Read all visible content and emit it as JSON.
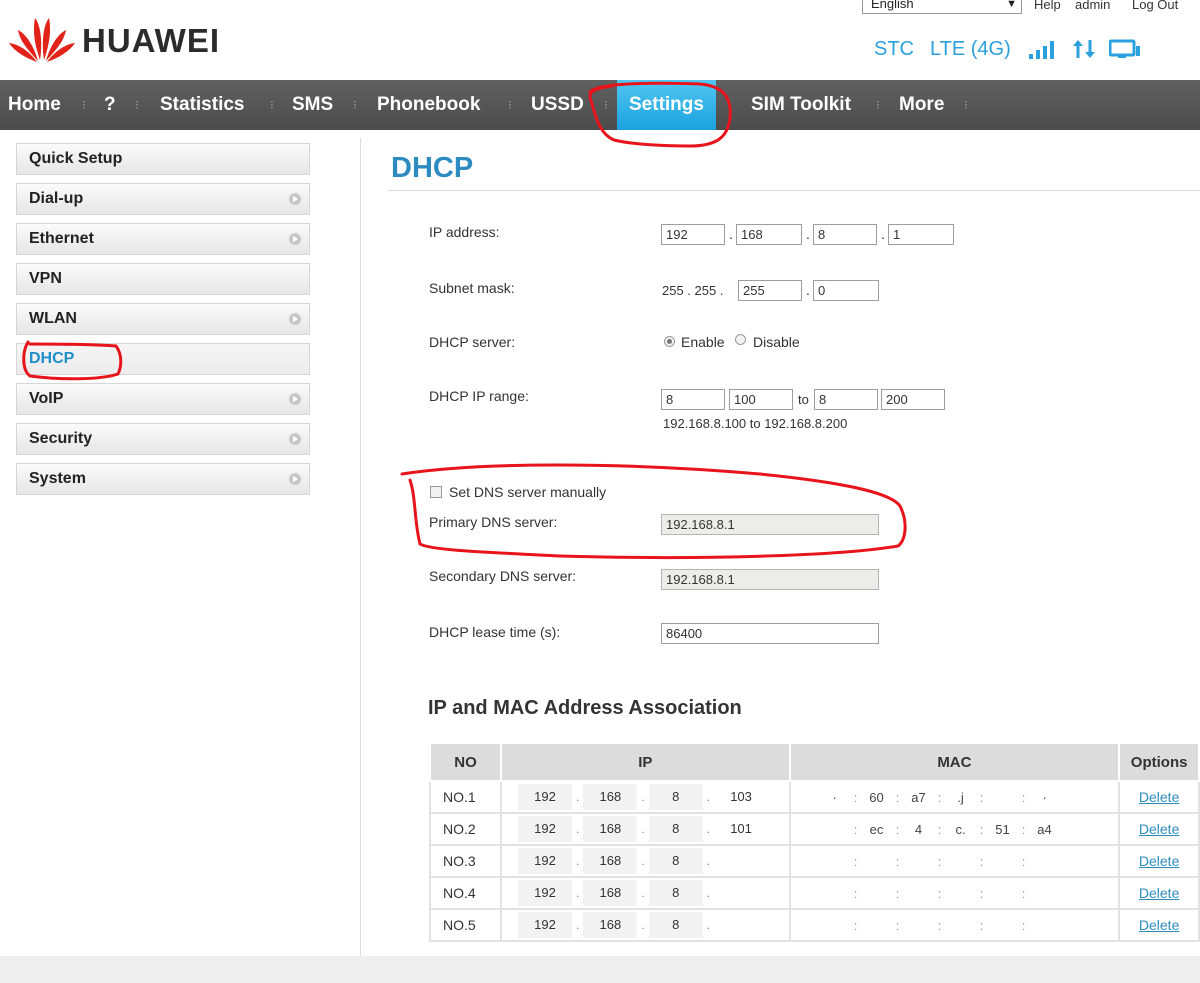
{
  "header": {
    "brand": "HUAWEI",
    "language": "English",
    "links": {
      "help": "Help",
      "user": "admin",
      "logout": "Log Out"
    },
    "status": {
      "operator": "STC",
      "network": "LTE (4G)"
    }
  },
  "nav": {
    "items": [
      "Home",
      "?",
      "Statistics",
      "SMS",
      "Phonebook",
      "USSD",
      "Settings",
      "SIM Toolkit",
      "More"
    ],
    "active": "Settings"
  },
  "sidebar": {
    "items": [
      "Quick Setup",
      "Dial-up",
      "Ethernet",
      "VPN",
      "WLAN",
      "DHCP",
      "VoIP",
      "Security",
      "System"
    ],
    "active": "DHCP"
  },
  "page": {
    "title": "DHCP"
  },
  "form": {
    "ip_address": {
      "label": "IP address:",
      "o1": "192",
      "o2": "168",
      "o3": "8",
      "o4": "1"
    },
    "subnet": {
      "label": "Subnet mask:",
      "fixed": "255 . 255 .",
      "o3": "255",
      "o4": "0"
    },
    "dhcp_server": {
      "label": "DHCP server:",
      "enable": "Enable",
      "disable": "Disable"
    },
    "ip_range": {
      "label": "DHCP IP range:",
      "start3": "8",
      "start4": "100",
      "to": "to",
      "end3": "8",
      "end4": "200",
      "summary": "192.168.8.100 to 192.168.8.200"
    },
    "dns_manual": "Set DNS server manually",
    "primary_dns": {
      "label": "Primary DNS server:",
      "value": "192.168.8.1"
    },
    "secondary_dns": {
      "label": "Secondary DNS server:",
      "value": "192.168.8.1"
    },
    "lease": {
      "label": "DHCP lease time (s):",
      "value": "86400"
    }
  },
  "association": {
    "title": "IP and MAC Address Association",
    "headers": {
      "no": "NO",
      "ip": "IP",
      "mac": "MAC",
      "options": "Options"
    },
    "delete_label": "Delete",
    "rows": [
      {
        "no": "NO.1",
        "ip": [
          "192",
          "168",
          "8",
          "103"
        ],
        "mac": [
          "·",
          "60",
          "a7",
          ".j",
          "",
          "·"
        ]
      },
      {
        "no": "NO.2",
        "ip": [
          "192",
          "168",
          "8",
          "101"
        ],
        "mac": [
          "",
          "ec",
          "4",
          "c.",
          "51",
          "a4"
        ]
      },
      {
        "no": "NO.3",
        "ip": [
          "192",
          "168",
          "8",
          ""
        ],
        "mac": [
          "",
          "",
          "",
          "",
          "",
          ""
        ]
      },
      {
        "no": "NO.4",
        "ip": [
          "192",
          "168",
          "8",
          ""
        ],
        "mac": [
          "",
          "",
          "",
          "",
          "",
          ""
        ]
      },
      {
        "no": "NO.5",
        "ip": [
          "192",
          "168",
          "8",
          ""
        ],
        "mac": [
          "",
          "",
          "",
          "",
          "",
          ""
        ]
      }
    ]
  },
  "colors": {
    "accent": "#2d8bc2",
    "nav_bg": "#555555",
    "nav_active": "#1aa2dd",
    "annotation": "#e8141c"
  }
}
